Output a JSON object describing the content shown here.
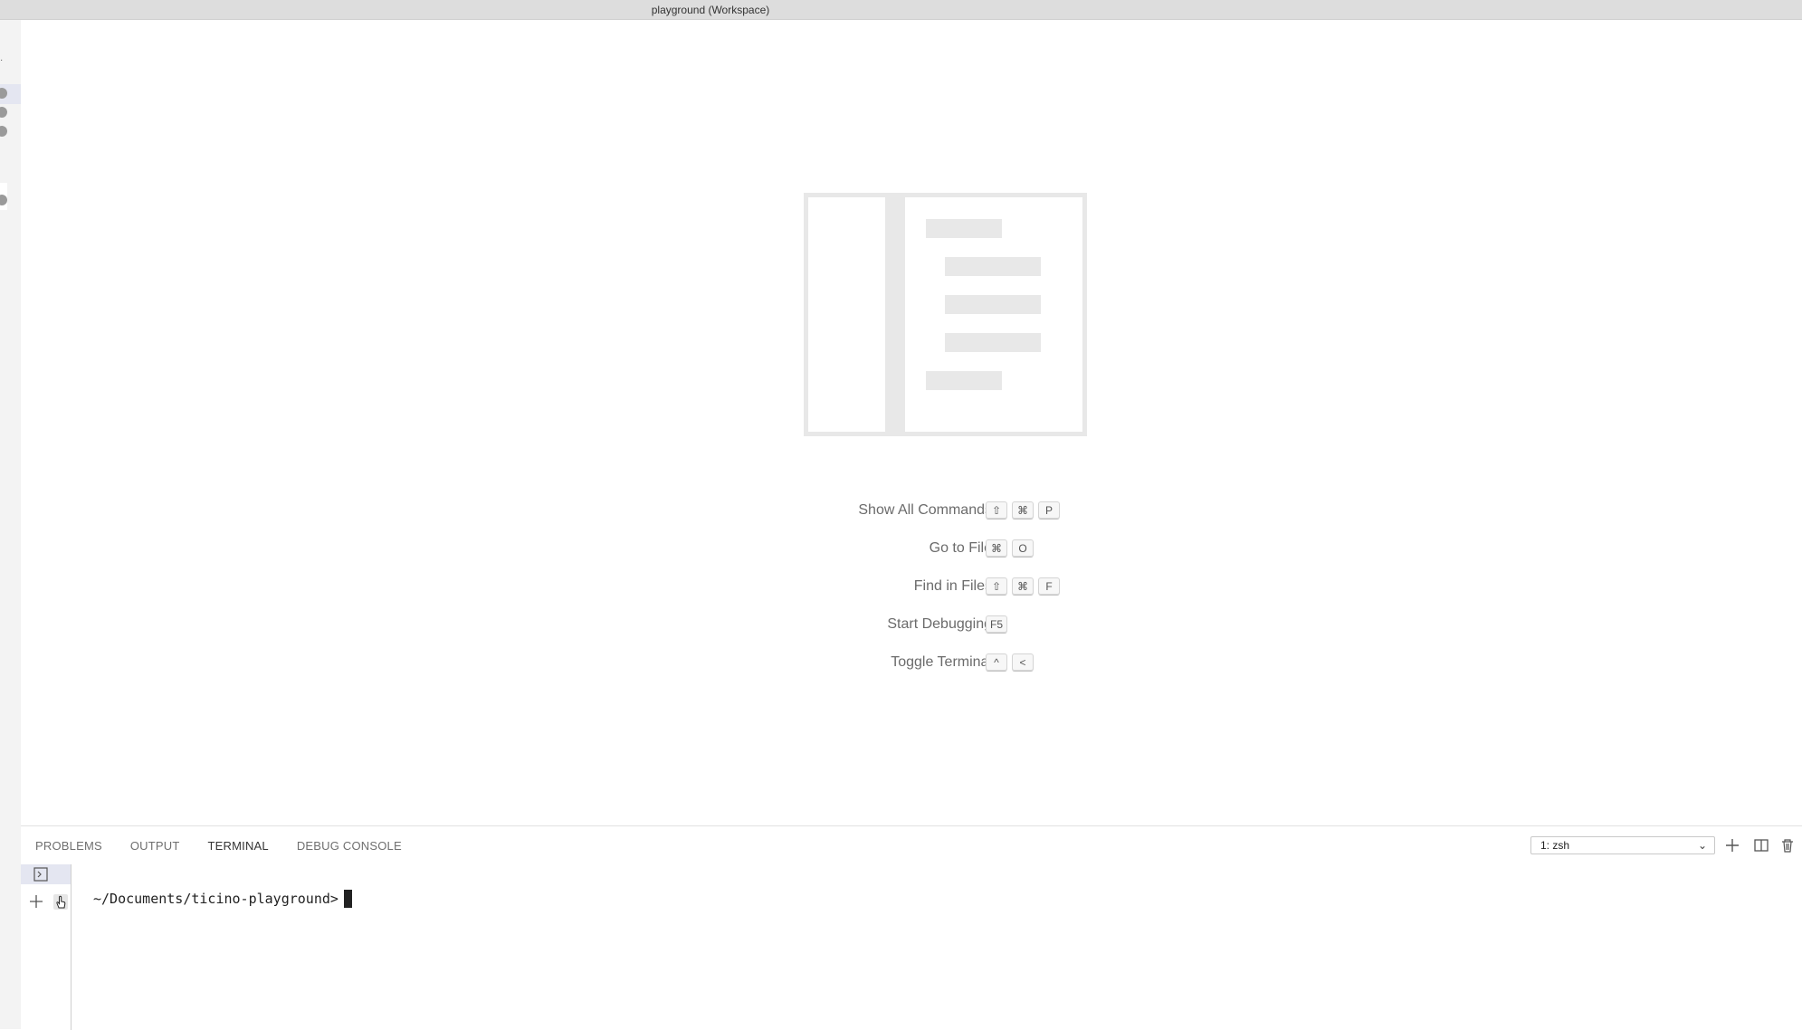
{
  "window": {
    "title": "playground (Workspace)"
  },
  "editor": {
    "shortcuts": [
      {
        "label": "Show All Commands",
        "keys": [
          "⇧",
          "⌘",
          "P"
        ]
      },
      {
        "label": "Go to File",
        "keys": [
          "⌘",
          "O"
        ]
      },
      {
        "label": "Find in Files",
        "keys": [
          "⇧",
          "⌘",
          "F"
        ]
      },
      {
        "label": "Start Debugging",
        "keys": [
          "F5"
        ]
      },
      {
        "label": "Toggle Terminal",
        "keys": [
          "^",
          "<"
        ]
      }
    ]
  },
  "panel": {
    "tabs": [
      {
        "label": "PROBLEMS",
        "active": false
      },
      {
        "label": "OUTPUT",
        "active": false
      },
      {
        "label": "TERMINAL",
        "active": true
      },
      {
        "label": "DEBUG CONSOLE",
        "active": false
      }
    ],
    "terminal_select": "1: zsh",
    "actions": [
      "add-icon",
      "split-icon",
      "trash-icon"
    ]
  },
  "terminal": {
    "prompt": "~/Documents/ticino-playground>"
  },
  "colors": {
    "titlebar": "#dddddd",
    "activitybar": "#f3f3f3",
    "selection": "#e4e6f1",
    "watermark": "#e8e8e8"
  }
}
